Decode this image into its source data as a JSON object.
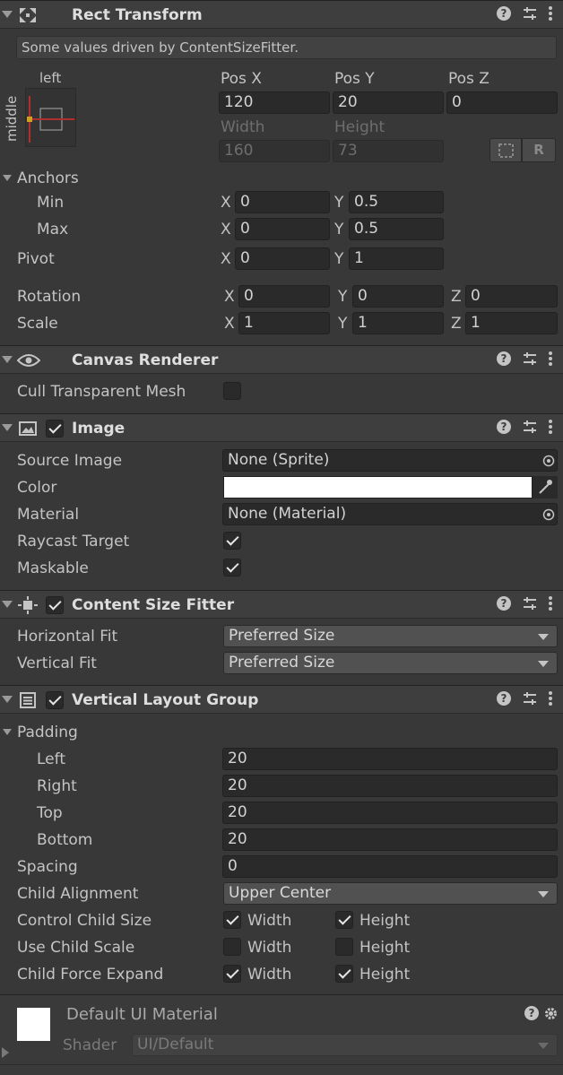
{
  "rect_transform": {
    "title": "Rect Transform",
    "notice": "Some values driven by ContentSizeFitter.",
    "anchor_preset": {
      "h": "left",
      "v": "middle"
    },
    "pos": {
      "x_label": "Pos X",
      "y_label": "Pos Y",
      "z_label": "Pos Z",
      "x": "120",
      "y": "20",
      "z": "0"
    },
    "size": {
      "w_label": "Width",
      "h_label": "Height",
      "w": "160",
      "h": "73"
    },
    "raw_button": "R",
    "anchors_label": "Anchors",
    "min_label": "Min",
    "max_label": "Max",
    "pivot_label": "Pivot",
    "min": {
      "x": "0",
      "y": "0.5"
    },
    "max": {
      "x": "0",
      "y": "0.5"
    },
    "pivot": {
      "x": "0",
      "y": "1"
    },
    "rotation_label": "Rotation",
    "scale_label": "Scale",
    "rotation": {
      "x": "0",
      "y": "0",
      "z": "0"
    },
    "scale": {
      "x": "1",
      "y": "1",
      "z": "1"
    },
    "axis": {
      "x": "X",
      "y": "Y",
      "z": "Z"
    }
  },
  "canvas_renderer": {
    "title": "Canvas Renderer",
    "cull_label": "Cull Transparent Mesh",
    "cull": false
  },
  "image": {
    "title": "Image",
    "source_label": "Source Image",
    "source_value": "None (Sprite)",
    "color_label": "Color",
    "color_value": "#ffffff",
    "material_label": "Material",
    "material_value": "None (Material)",
    "raycast_label": "Raycast Target",
    "raycast": true,
    "maskable_label": "Maskable",
    "maskable": true
  },
  "content_size_fitter": {
    "title": "Content Size Fitter",
    "hfit_label": "Horizontal Fit",
    "hfit_value": "Preferred Size",
    "vfit_label": "Vertical Fit",
    "vfit_value": "Preferred Size"
  },
  "vertical_layout_group": {
    "title": "Vertical Layout Group",
    "padding_label": "Padding",
    "left_label": "Left",
    "left": "20",
    "right_label": "Right",
    "right": "20",
    "top_label": "Top",
    "top": "20",
    "bottom_label": "Bottom",
    "bottom": "20",
    "spacing_label": "Spacing",
    "spacing": "0",
    "alignment_label": "Child Alignment",
    "alignment": "Upper Center",
    "control_label": "Control Child Size",
    "use_scale_label": "Use Child Scale",
    "force_label": "Child Force Expand",
    "width_label": "Width",
    "height_label": "Height",
    "control": {
      "width": true,
      "height": true
    },
    "use_scale": {
      "width": false,
      "height": false
    },
    "force": {
      "width": true,
      "height": true
    }
  },
  "material_preview": {
    "name": "Default UI Material",
    "shader_label": "Shader",
    "shader_value": "UI/Default"
  }
}
